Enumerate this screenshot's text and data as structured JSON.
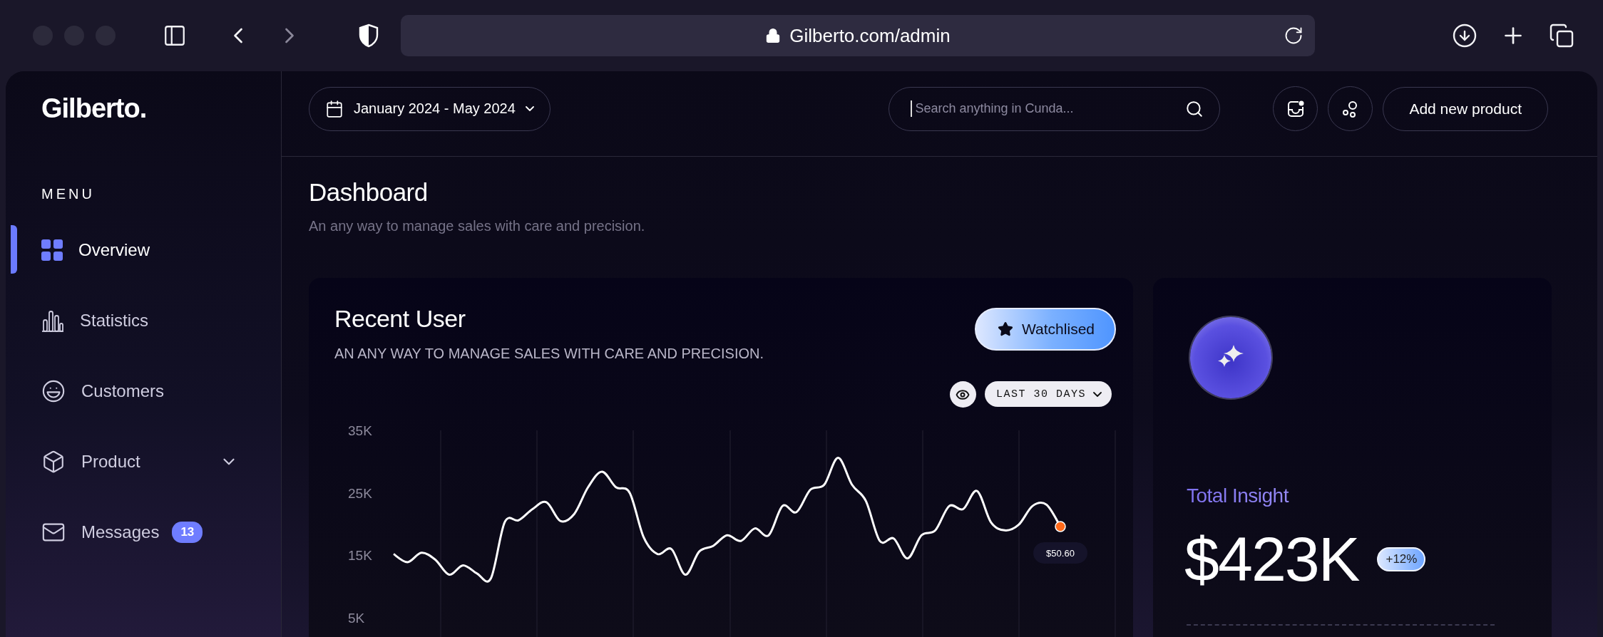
{
  "browser": {
    "url": "Gilberto.com/admin"
  },
  "sidebar": {
    "logo": "Gilberto.",
    "menu_heading": "MENU",
    "items": [
      {
        "label": "Overview",
        "selected": true,
        "kind": "link"
      },
      {
        "label": "Statistics",
        "selected": false,
        "kind": "link"
      },
      {
        "label": "Customers",
        "selected": false,
        "kind": "link"
      },
      {
        "label": "Product",
        "selected": false,
        "kind": "group",
        "expanded": false
      },
      {
        "label": "Messages",
        "selected": false,
        "kind": "link",
        "badge": "13"
      }
    ]
  },
  "topbar": {
    "date_range": "January 2024 - May 2024",
    "search": {
      "placeholder": "Search anything in Cunda..."
    },
    "add_button": "Add new product"
  },
  "page": {
    "title": "Dashboard",
    "subtitle": "An any way to manage sales with care and precision."
  },
  "recent_user": {
    "title": "Recent User",
    "subtitle": "AN ANY WAY TO MANAGE SALES WITH CARE AND PRECISION.",
    "watchlist_button": "Watchlised",
    "range_select": "LAST 30 DAYS",
    "chart_data": {
      "type": "line",
      "grid": true,
      "ylim": [
        5000,
        35000
      ],
      "yticks": [
        {
          "value": 5000,
          "label": "5K"
        },
        {
          "value": 15000,
          "label": "15K"
        },
        {
          "value": 25000,
          "label": "25K"
        },
        {
          "value": 35000,
          "label": "35K"
        }
      ],
      "series": [
        {
          "color": "#ffffff",
          "values": [
            15200,
            13900,
            15400,
            14300,
            11900,
            13400,
            12100,
            11300,
            20300,
            20600,
            22400,
            23500,
            20500,
            21600,
            25900,
            28400,
            25900,
            25000,
            17900,
            15200,
            16000,
            11900,
            15600,
            16500,
            18200,
            17300,
            19300,
            18200,
            22900,
            21900,
            25500,
            26300,
            30600,
            26300,
            23700,
            17300,
            17700,
            14500,
            18200,
            19000,
            22900,
            22400,
            25300,
            20300,
            19000,
            19900,
            22900,
            23100,
            19600
          ]
        }
      ],
      "annotations": [
        {
          "text": "$50.60"
        }
      ]
    }
  },
  "insight": {
    "title": "Total Insight",
    "value": "$423K",
    "change": "+12%"
  }
}
